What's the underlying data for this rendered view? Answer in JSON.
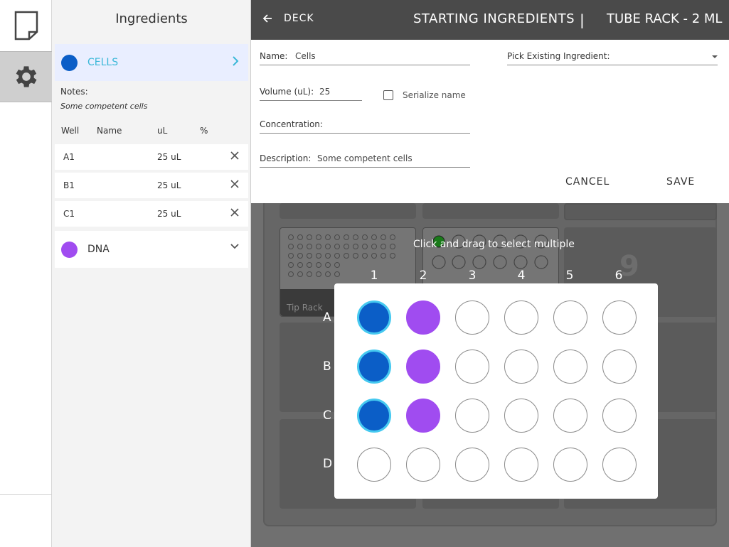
{
  "sidebar": {
    "title": "Ingredients",
    "ingredients": [
      {
        "name": "CELLS",
        "color": "#0b5ec7",
        "expanded": true
      },
      {
        "name": "DNA",
        "color": "#a04cf0",
        "expanded": false
      }
    ],
    "notes_label": "Notes:",
    "notes_text": "Some competent cells",
    "table_headers": {
      "well": "Well",
      "name": "Name",
      "ul": "uL",
      "pct": "%"
    },
    "wells": [
      {
        "well": "A1",
        "volume": "25 uL"
      },
      {
        "well": "B1",
        "volume": "25 uL"
      },
      {
        "well": "C1",
        "volume": "25 uL"
      }
    ]
  },
  "header": {
    "back_label": "DECK",
    "title": "STARTING INGREDIENTS",
    "separator": "|",
    "subtitle": "TUBE RACK - 2 ML"
  },
  "form": {
    "name_label": "Name:",
    "name_value": "Cells",
    "volume_label": "Volume (uL):",
    "volume_value": "25",
    "serialize_label": "Serialize name",
    "serialize_checked": false,
    "concentration_label": "Concentration:",
    "concentration_value": "",
    "description_label": "Description:",
    "description_value": "Some competent cells",
    "pick_existing_label": "Pick Existing Ingredient:",
    "cancel_label": "CANCEL",
    "save_label": "SAVE"
  },
  "deck": {
    "tip_rack_label": "Tip Rack",
    "slot_number": "9"
  },
  "plate": {
    "hint": "Click and drag to select multiple",
    "columns": [
      "1",
      "2",
      "3",
      "4",
      "5",
      "6"
    ],
    "rows": [
      "A",
      "B",
      "C",
      "D"
    ],
    "filled": {
      "A1": "cells",
      "B1": "cells",
      "C1": "cells",
      "A2": "dna",
      "B2": "dna",
      "C2": "dna"
    }
  },
  "colors": {
    "cells": "#0b5ec7",
    "cells_highlight": "#46c9f0",
    "dna": "#a04cf0",
    "header_bg": "#4a4a4a",
    "active_accent": "#3bb8d8"
  }
}
